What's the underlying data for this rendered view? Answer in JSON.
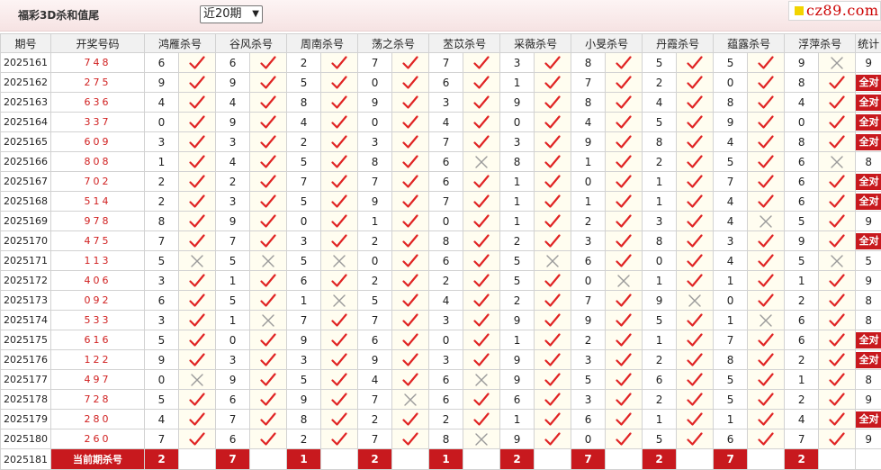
{
  "header": {
    "title": "福彩3D杀和值尾",
    "period_select": "近20期",
    "logo_text": "cz89.com"
  },
  "columns": {
    "period": "期号",
    "numbers": "开奖号码",
    "experts": [
      "鸿雁杀号",
      "谷风杀号",
      "周南杀号",
      "荡之杀号",
      "苤苡杀号",
      "采薇杀号",
      "小旻杀号",
      "丹霞杀号",
      "蕴露杀号",
      "浮萍杀号"
    ],
    "stat": "统计"
  },
  "legend": {
    "hit": "check-icon",
    "miss": "cross-icon",
    "all_correct_label": "全对"
  },
  "rows": [
    {
      "period": "2025161",
      "numbers": "748",
      "kills": [
        6,
        6,
        2,
        7,
        7,
        3,
        8,
        5,
        5,
        9
      ],
      "hits": [
        1,
        1,
        1,
        1,
        1,
        1,
        1,
        1,
        1,
        0
      ],
      "stat": "9"
    },
    {
      "period": "2025162",
      "numbers": "275",
      "kills": [
        9,
        9,
        5,
        0,
        6,
        1,
        7,
        2,
        0,
        8
      ],
      "hits": [
        1,
        1,
        1,
        1,
        1,
        1,
        1,
        1,
        1,
        1
      ],
      "stat": "全对"
    },
    {
      "period": "2025163",
      "numbers": "636",
      "kills": [
        4,
        4,
        8,
        9,
        3,
        9,
        8,
        4,
        8,
        4
      ],
      "hits": [
        1,
        1,
        1,
        1,
        1,
        1,
        1,
        1,
        1,
        1
      ],
      "stat": "全对"
    },
    {
      "period": "2025164",
      "numbers": "337",
      "kills": [
        0,
        9,
        4,
        0,
        4,
        0,
        4,
        5,
        9,
        0
      ],
      "hits": [
        1,
        1,
        1,
        1,
        1,
        1,
        1,
        1,
        1,
        1
      ],
      "stat": "全对"
    },
    {
      "period": "2025165",
      "numbers": "609",
      "kills": [
        3,
        3,
        2,
        3,
        7,
        3,
        9,
        8,
        4,
        8
      ],
      "hits": [
        1,
        1,
        1,
        1,
        1,
        1,
        1,
        1,
        1,
        1
      ],
      "stat": "全对"
    },
    {
      "period": "2025166",
      "numbers": "808",
      "kills": [
        1,
        4,
        5,
        8,
        6,
        8,
        1,
        2,
        5,
        6
      ],
      "hits": [
        1,
        1,
        1,
        1,
        0,
        1,
        1,
        1,
        1,
        0
      ],
      "stat": "8"
    },
    {
      "period": "2025167",
      "numbers": "702",
      "kills": [
        2,
        2,
        7,
        7,
        6,
        1,
        0,
        1,
        7,
        6
      ],
      "hits": [
        1,
        1,
        1,
        1,
        1,
        1,
        1,
        1,
        1,
        1
      ],
      "stat": "全对"
    },
    {
      "period": "2025168",
      "numbers": "514",
      "kills": [
        2,
        3,
        5,
        9,
        7,
        1,
        1,
        1,
        4,
        6
      ],
      "hits": [
        1,
        1,
        1,
        1,
        1,
        1,
        1,
        1,
        1,
        1
      ],
      "stat": "全对"
    },
    {
      "period": "2025169",
      "numbers": "978",
      "kills": [
        8,
        9,
        0,
        1,
        0,
        1,
        2,
        3,
        4,
        5
      ],
      "hits": [
        1,
        1,
        1,
        1,
        1,
        1,
        1,
        1,
        0,
        1
      ],
      "stat": "9"
    },
    {
      "period": "2025170",
      "numbers": "475",
      "kills": [
        7,
        7,
        3,
        2,
        8,
        2,
        3,
        8,
        3,
        9
      ],
      "hits": [
        1,
        1,
        1,
        1,
        1,
        1,
        1,
        1,
        1,
        1
      ],
      "stat": "全对"
    },
    {
      "period": "2025171",
      "numbers": "113",
      "kills": [
        5,
        5,
        5,
        0,
        6,
        5,
        6,
        0,
        4,
        5
      ],
      "hits": [
        0,
        0,
        0,
        1,
        1,
        0,
        1,
        1,
        1,
        0
      ],
      "stat": "5"
    },
    {
      "period": "2025172",
      "numbers": "406",
      "kills": [
        3,
        1,
        6,
        2,
        2,
        5,
        0,
        1,
        1,
        1
      ],
      "hits": [
        1,
        1,
        1,
        1,
        1,
        1,
        0,
        1,
        1,
        1
      ],
      "stat": "9"
    },
    {
      "period": "2025173",
      "numbers": "092",
      "kills": [
        6,
        5,
        1,
        5,
        4,
        2,
        7,
        9,
        0,
        2
      ],
      "hits": [
        1,
        1,
        0,
        1,
        1,
        1,
        1,
        0,
        1,
        1
      ],
      "stat": "8"
    },
    {
      "period": "2025174",
      "numbers": "533",
      "kills": [
        3,
        1,
        7,
        7,
        3,
        9,
        9,
        5,
        1,
        6
      ],
      "hits": [
        1,
        0,
        1,
        1,
        1,
        1,
        1,
        1,
        0,
        1
      ],
      "stat": "8"
    },
    {
      "period": "2025175",
      "numbers": "616",
      "kills": [
        5,
        0,
        9,
        6,
        0,
        1,
        2,
        1,
        7,
        6
      ],
      "hits": [
        1,
        1,
        1,
        1,
        1,
        1,
        1,
        1,
        1,
        1
      ],
      "stat": "全对"
    },
    {
      "period": "2025176",
      "numbers": "122",
      "kills": [
        9,
        3,
        3,
        9,
        3,
        9,
        3,
        2,
        8,
        2
      ],
      "hits": [
        1,
        1,
        1,
        1,
        1,
        1,
        1,
        1,
        1,
        1
      ],
      "stat": "全对"
    },
    {
      "period": "2025177",
      "numbers": "497",
      "kills": [
        0,
        9,
        5,
        4,
        6,
        9,
        5,
        6,
        5,
        1
      ],
      "hits": [
        0,
        1,
        1,
        1,
        0,
        1,
        1,
        1,
        1,
        1
      ],
      "stat": "8"
    },
    {
      "period": "2025178",
      "numbers": "728",
      "kills": [
        5,
        6,
        9,
        7,
        6,
        6,
        3,
        2,
        5,
        2
      ],
      "hits": [
        1,
        1,
        1,
        0,
        1,
        1,
        1,
        1,
        1,
        1
      ],
      "stat": "9"
    },
    {
      "period": "2025179",
      "numbers": "280",
      "kills": [
        4,
        7,
        8,
        2,
        2,
        1,
        6,
        1,
        1,
        4
      ],
      "hits": [
        1,
        1,
        1,
        1,
        1,
        1,
        1,
        1,
        1,
        1
      ],
      "stat": "全对"
    },
    {
      "period": "2025180",
      "numbers": "260",
      "kills": [
        7,
        6,
        2,
        7,
        8,
        9,
        0,
        5,
        6,
        7
      ],
      "hits": [
        1,
        1,
        1,
        1,
        0,
        1,
        1,
        1,
        1,
        1
      ],
      "stat": "9"
    }
  ],
  "current": {
    "period": "2025181",
    "label": "当前期杀号",
    "kills": [
      2,
      7,
      1,
      2,
      1,
      2,
      7,
      2,
      7,
      2
    ]
  }
}
